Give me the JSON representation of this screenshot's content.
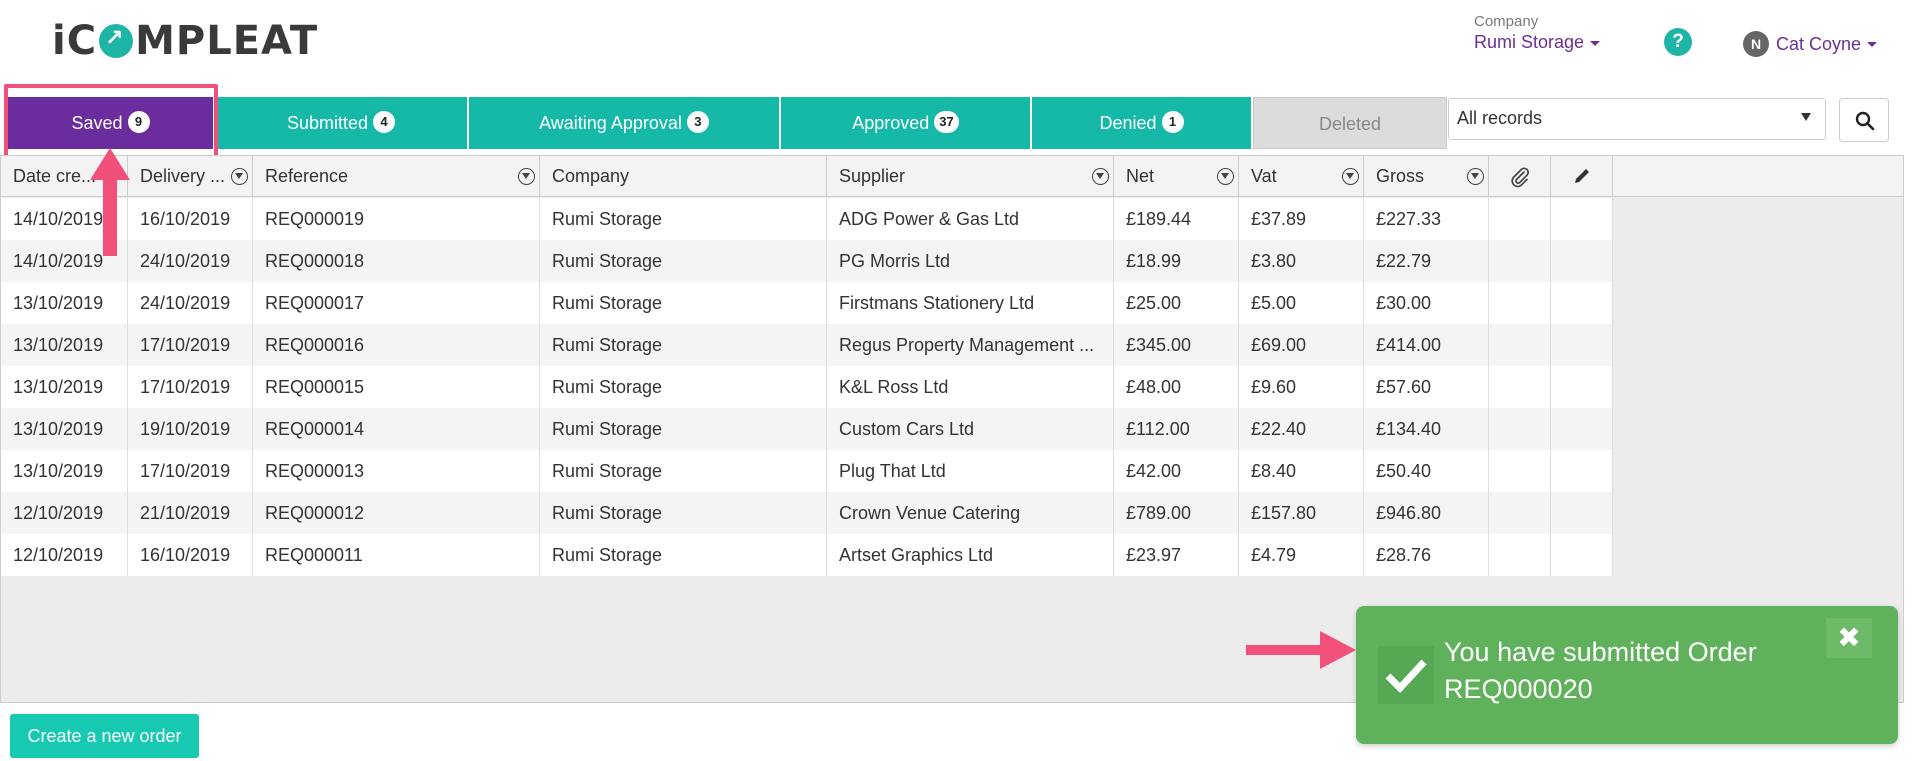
{
  "header": {
    "logo_text": "iCOMPLEAT",
    "company_label": "Company",
    "company_value": "Rumi Storage",
    "help_icon": "question-circle-icon",
    "help_glyph": "?",
    "user_initial": "N",
    "user_name": "Cat Coyne"
  },
  "tabs": [
    {
      "label": "Saved",
      "count": "9"
    },
    {
      "label": "Submitted",
      "count": "4"
    },
    {
      "label": "Awaiting Approval",
      "count": "3"
    },
    {
      "label": "Approved",
      "count": "37"
    },
    {
      "label": "Denied",
      "count": "1"
    },
    {
      "label": "Deleted",
      "count": ""
    }
  ],
  "filter": {
    "selected": "All records"
  },
  "table": {
    "headers": {
      "date_created": "Date cre...",
      "delivery": "Delivery ...",
      "reference": "Reference",
      "company": "Company",
      "supplier": "Supplier",
      "net": "Net",
      "vat": "Vat",
      "gross": "Gross",
      "attachment_icon": "paperclip-icon",
      "edit_icon": "pencil-icon"
    },
    "rows": [
      {
        "date": "14/10/2019",
        "delivery": "16/10/2019",
        "ref": "REQ000019",
        "company": "Rumi Storage",
        "supplier": "ADG Power & Gas Ltd",
        "net": "£189.44",
        "vat": "£37.89",
        "gross": "£227.33"
      },
      {
        "date": "14/10/2019",
        "delivery": "24/10/2019",
        "ref": "REQ000018",
        "company": "Rumi Storage",
        "supplier": "PG Morris Ltd",
        "net": "£18.99",
        "vat": "£3.80",
        "gross": "£22.79"
      },
      {
        "date": "13/10/2019",
        "delivery": "24/10/2019",
        "ref": "REQ000017",
        "company": "Rumi Storage",
        "supplier": "Firstmans Stationery Ltd",
        "net": "£25.00",
        "vat": "£5.00",
        "gross": "£30.00"
      },
      {
        "date": "13/10/2019",
        "delivery": "17/10/2019",
        "ref": "REQ000016",
        "company": "Rumi Storage",
        "supplier": "Regus Property Management ...",
        "net": "£345.00",
        "vat": "£69.00",
        "gross": "£414.00"
      },
      {
        "date": "13/10/2019",
        "delivery": "17/10/2019",
        "ref": "REQ000015",
        "company": "Rumi Storage",
        "supplier": "K&L Ross Ltd",
        "net": "£48.00",
        "vat": "£9.60",
        "gross": "£57.60"
      },
      {
        "date": "13/10/2019",
        "delivery": "19/10/2019",
        "ref": "REQ000014",
        "company": "Rumi Storage",
        "supplier": "Custom Cars Ltd",
        "net": "£112.00",
        "vat": "£22.40",
        "gross": "£134.40"
      },
      {
        "date": "13/10/2019",
        "delivery": "17/10/2019",
        "ref": "REQ000013",
        "company": "Rumi Storage",
        "supplier": "Plug That Ltd",
        "net": "£42.00",
        "vat": "£8.40",
        "gross": "£50.40"
      },
      {
        "date": "12/10/2019",
        "delivery": "21/10/2019",
        "ref": "REQ000012",
        "company": "Rumi Storage",
        "supplier": "Crown Venue Catering",
        "net": "£789.00",
        "vat": "£157.80",
        "gross": "£946.80"
      },
      {
        "date": "12/10/2019",
        "delivery": "16/10/2019",
        "ref": "REQ000011",
        "company": "Rumi Storage",
        "supplier": "Artset Graphics Ltd",
        "net": "£23.97",
        "vat": "£4.79",
        "gross": "£28.76"
      }
    ]
  },
  "actions": {
    "create_label": "Create a new order"
  },
  "toast": {
    "message": "You have submitted Order REQ000020",
    "close_glyph": "✖"
  },
  "colors": {
    "brand_purple": "#6b2d9e",
    "brand_teal": "#16b9a8",
    "toast_green": "#5fb25b",
    "annotation_pink": "#f0507a"
  }
}
